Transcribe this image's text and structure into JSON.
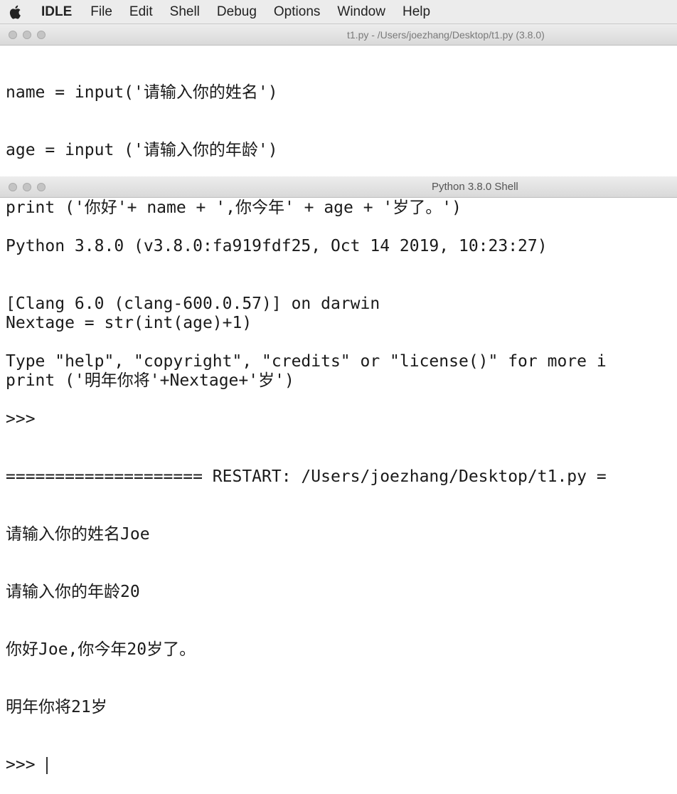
{
  "menubar": {
    "apple_icon": "apple-icon",
    "items": [
      "IDLE",
      "File",
      "Edit",
      "Shell",
      "Debug",
      "Options",
      "Window",
      "Help"
    ]
  },
  "editor": {
    "title": "t1.py - /Users/joezhang/Desktop/t1.py (3.8.0)",
    "lines": [
      "name = input('请输入你的姓名')",
      "age = input ('请输入你的年龄')",
      "print ('你好'+ name + ',你今年' + age + '岁了。')",
      "",
      "Nextage = str(int(age)+1)",
      "print ('明年你将'+Nextage+'岁')"
    ]
  },
  "shell": {
    "title": "Python 3.8.0 Shell",
    "lines": [
      "Python 3.8.0 (v3.8.0:fa919fdf25, Oct 14 2019, 10:23:27)",
      "[Clang 6.0 (clang-600.0.57)] on darwin",
      "Type \"help\", \"copyright\", \"credits\" or \"license()\" for more i",
      ">>>",
      "==================== RESTART: /Users/joezhang/Desktop/t1.py =",
      "请输入你的姓名Joe",
      "请输入你的年龄20",
      "你好Joe,你今年20岁了。",
      "明年你将21岁"
    ],
    "prompt": ">>> "
  }
}
